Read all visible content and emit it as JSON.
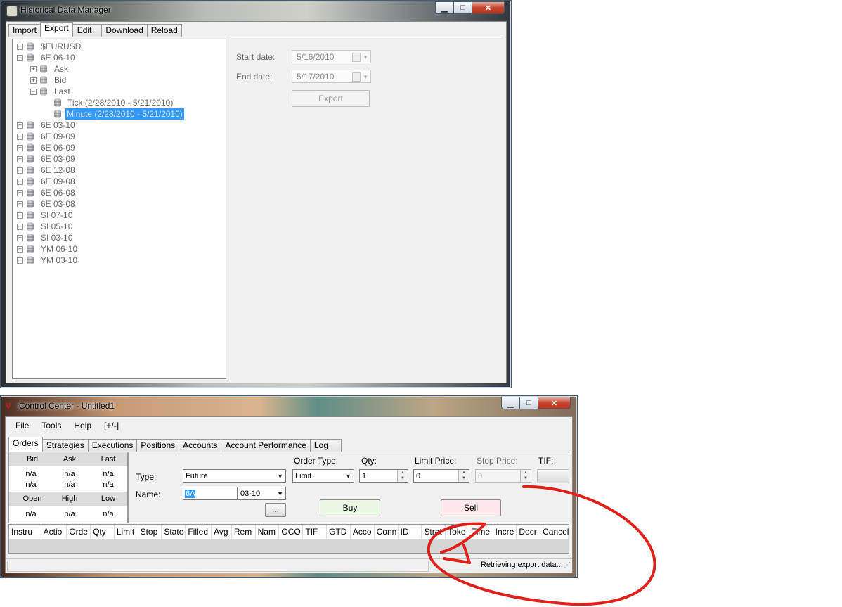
{
  "colors": {
    "selection": "#3399ff",
    "annotation": "#e0201b"
  },
  "hdm": {
    "title": "Historical Data Manager",
    "app_icon": "app-icon",
    "tabs": [
      "Import",
      "Export",
      "Edit",
      "Download",
      "Reload"
    ],
    "tree": {
      "n0": "$EURUSD",
      "n1": "6E 06-10",
      "n2": "Ask",
      "n3": "Bid",
      "n4": "Last",
      "n5": "Tick (2/28/2010 - 5/21/2010)",
      "n6": "Minute (2/28/2010 - 5/21/2010)",
      "n7": "6E 03-10",
      "n8": "6E 09-09",
      "n9": "6E 06-09",
      "n10": "6E 03-09",
      "n11": "6E 12-08",
      "n12": "6E 09-08",
      "n13": "6E 06-08",
      "n14": "6E 03-08",
      "n15": "SI 07-10",
      "n16": "SI 05-10",
      "n17": "SI 03-10",
      "n18": "YM 06-10",
      "n19": "YM 03-10"
    },
    "start_label": "Start date:",
    "start_value": "5/16/2010",
    "end_label": "End date:",
    "end_value": "5/17/2010",
    "export_button": "Export"
  },
  "cc": {
    "title": "Control Center - Untitled1",
    "menu": [
      "File",
      "Tools",
      "Help",
      "[+/-]"
    ],
    "tabs": [
      "Orders",
      "Strategies",
      "Executions",
      "Positions",
      "Accounts",
      "Account Performance",
      "Log"
    ],
    "quote": {
      "bid": "Bid",
      "ask": "Ask",
      "last": "Last",
      "bid_v1": "n/a",
      "ask_v1": "n/a",
      "last_v1": "n/a",
      "bid_v2": "n/a",
      "ask_v2": "n/a",
      "last_v2": "n/a",
      "open": "Open",
      "high": "High",
      "low": "Low",
      "open_v": "n/a",
      "high_v": "n/a",
      "low_v": "n/a"
    },
    "type_label": "Type:",
    "type_value": "Future",
    "name_label": "Name:",
    "name_value": "6A",
    "expiry_value": "03-10",
    "browse_button": "...",
    "order_type_label": "Order Type:",
    "order_type_value": "Limit",
    "qty_label": "Qty:",
    "qty_value": "1",
    "limit_label": "Limit Price:",
    "limit_value": "0",
    "stop_label": "Stop Price:",
    "stop_value": "0",
    "tif_label": "TIF:",
    "buy_button": "Buy",
    "sell_button": "Sell",
    "columns": [
      "Instru",
      "Actio",
      "Orde",
      "Qty",
      "Limit",
      "Stop",
      "State",
      "Filled",
      "Avg",
      "Rem",
      "Nam",
      "OCO",
      "TIF",
      "GTD",
      "Acco",
      "Conn",
      "ID",
      "Strat",
      "Toke",
      "Time",
      "Incre",
      "Decr",
      "Cancel"
    ],
    "status_text": "Retrieving export data..."
  }
}
